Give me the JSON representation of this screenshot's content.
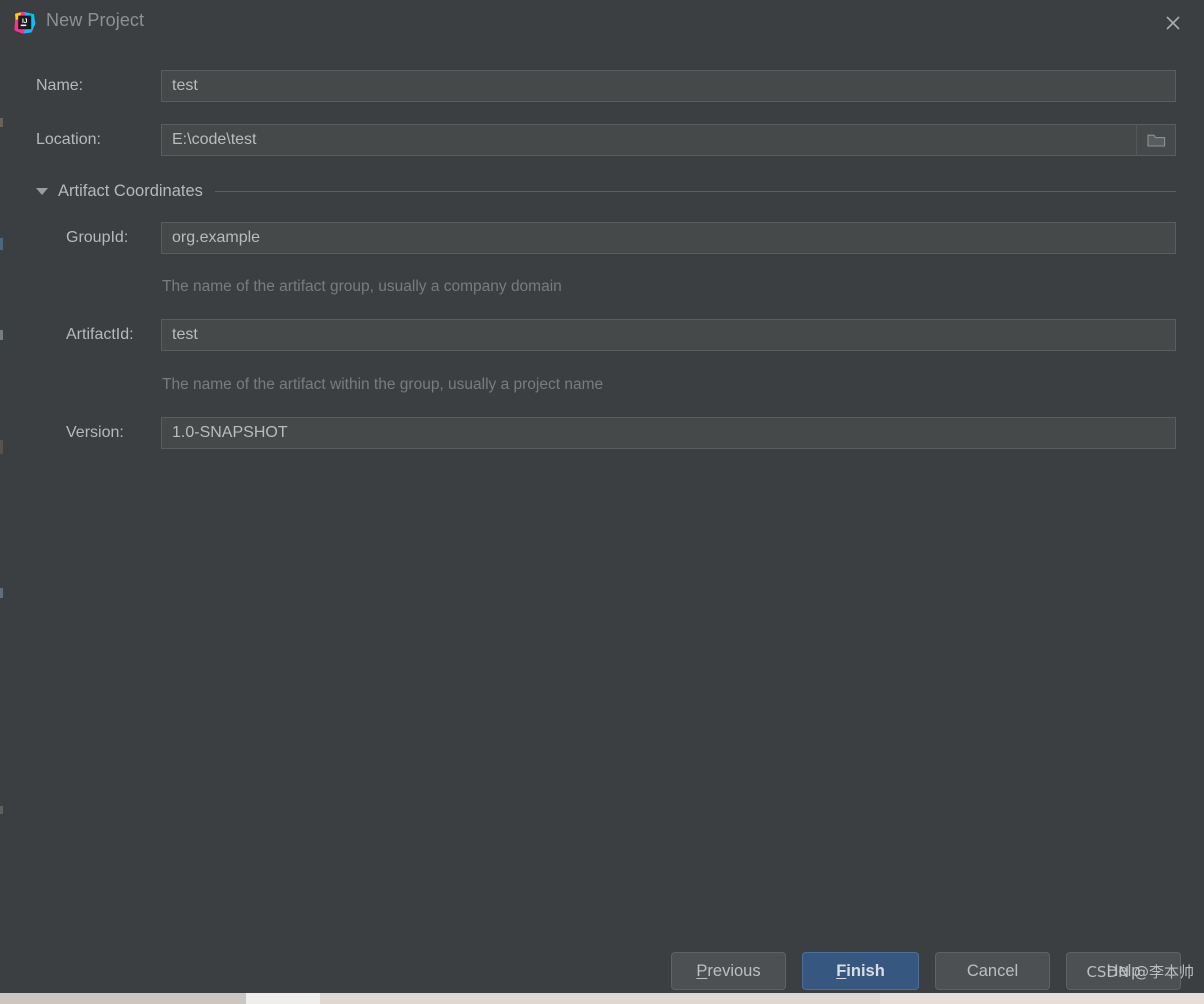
{
  "window": {
    "title": "New Project",
    "logo_icon": "intellij-idea-logo",
    "close_icon": "close-icon"
  },
  "form": {
    "name": {
      "label": "Name:",
      "value": "test"
    },
    "location": {
      "label": "Location:",
      "value": "E:\\code\\test",
      "browse_icon": "folder-icon"
    },
    "section": {
      "title": "Artifact Coordinates",
      "toggle_icon": "chevron-down-icon",
      "expanded": true
    },
    "group_id": {
      "label": "GroupId:",
      "value": "org.example",
      "hint": "The name of the artifact group, usually a company domain"
    },
    "artifact_id": {
      "label": "ArtifactId:",
      "value": "test",
      "hint": "The name of the artifact within the group, usually a project name"
    },
    "version": {
      "label": "Version:",
      "value": "1.0-SNAPSHOT"
    }
  },
  "buttons": {
    "previous": {
      "label": "Previous",
      "mnemonic": "P"
    },
    "finish": {
      "label": "Finish",
      "mnemonic": "F",
      "primary": true
    },
    "cancel": {
      "label": "Cancel"
    },
    "help": {
      "label": "Help"
    }
  },
  "watermark": {
    "text": "CSDN @李本帅"
  },
  "colors": {
    "dialog_bg": "#3c3f41",
    "field_bg": "#45494a",
    "field_border": "#5a5d5f",
    "text": "#b6b9bb",
    "hint_text": "#787c7f",
    "accent_button": "#365880",
    "accent_button_border": "#4b7199"
  }
}
